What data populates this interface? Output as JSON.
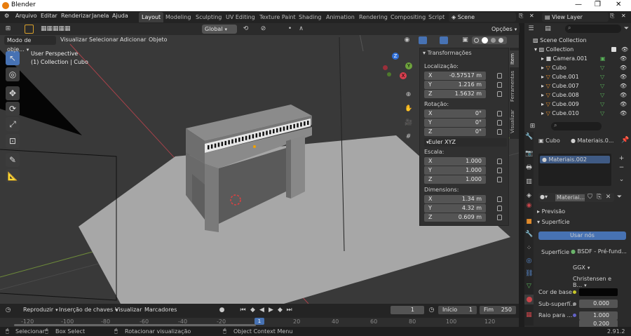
{
  "app": {
    "title": "Blender",
    "version": "2.91.2"
  },
  "menu": [
    "Arquivo",
    "Editar",
    "Renderizar",
    "Janela",
    "Ajuda"
  ],
  "workspaces": [
    "Layout",
    "Modeling",
    "Sculpting",
    "UV Editing",
    "Texture Paint",
    "Shading",
    "Animation",
    "Rendering",
    "Compositing",
    "Script"
  ],
  "scene": {
    "name": "Scene",
    "view_layer": "View Layer"
  },
  "viewport": {
    "mode": "Modo de obje...",
    "header_menu": [
      "Visualizar",
      "Selecionar",
      "Adicionar",
      "Objeto"
    ],
    "orientation": "Global",
    "options": "Opções",
    "overlay_line1": "User Perspective",
    "overlay_line2": "(1) Collection | Cubo",
    "gizmo": {
      "x": "X",
      "y": "Y",
      "z": "Z"
    }
  },
  "npanel": {
    "section": "Transformações",
    "location_label": "Localização:",
    "location": [
      {
        "a": "X",
        "v": "-0.57517 m"
      },
      {
        "a": "Y",
        "v": "1.216 m"
      },
      {
        "a": "Z",
        "v": "1.5632 m"
      }
    ],
    "rotation_label": "Rotação:",
    "rotation": [
      {
        "a": "X",
        "v": "0°"
      },
      {
        "a": "Y",
        "v": "0°"
      },
      {
        "a": "Z",
        "v": "0°"
      }
    ],
    "euler": "Euler XYZ",
    "scale_label": "Escala:",
    "scale": [
      {
        "a": "X",
        "v": "1.000"
      },
      {
        "a": "Y",
        "v": "1.000"
      },
      {
        "a": "Z",
        "v": "1.000"
      }
    ],
    "dims_label": "Dimensions:",
    "dims": [
      {
        "a": "X",
        "v": "1.34 m"
      },
      {
        "a": "Y",
        "v": "4.32 m"
      },
      {
        "a": "Z",
        "v": "0.609 m"
      }
    ],
    "tabs": [
      "Item",
      "Ferramentas",
      "Visualizar"
    ]
  },
  "outliner": {
    "root": "Scene Collection",
    "collection": "Collection",
    "items": [
      "Camera.001",
      "Cubo",
      "Cube.001",
      "Cube.007",
      "Cube.008",
      "Cube.009",
      "Cube.010"
    ]
  },
  "properties": {
    "object": "Cubo",
    "material_tab": "Materiais.0...",
    "slot": "Materiais.002",
    "material_name": "Materiai...",
    "preview": "Previsão",
    "surface": "Superfície",
    "use_nodes": "Usar nós",
    "surface_label": "Superfície",
    "surface_value": "BSDF - Pré-fund...",
    "distribution": "GGX",
    "subsurface_method": "Christensen e B...",
    "base_color_label": "Cor de base",
    "subsurface_label": "Sub-superfí...",
    "subsurface_value": "0.000",
    "radius_label": "Raio para ...",
    "radius_values": [
      "1.000",
      "0.200"
    ]
  },
  "timeline": {
    "menus": [
      "Reproduzir",
      "Inserção de chaves",
      "Visualizar",
      "Marcadores"
    ],
    "current_frame": "1",
    "start_label": "Início",
    "start": "1",
    "end_label": "Fim",
    "end": "250",
    "ruler": [
      "-120",
      "-100",
      "-80",
      "-60",
      "-40",
      "-20",
      "20",
      "40",
      "60",
      "80",
      "100",
      "120"
    ],
    "frame_marker": "1"
  },
  "status": [
    "Selecionar",
    "Box Select",
    "Rotacionar visualização",
    "Object Context Menu"
  ]
}
